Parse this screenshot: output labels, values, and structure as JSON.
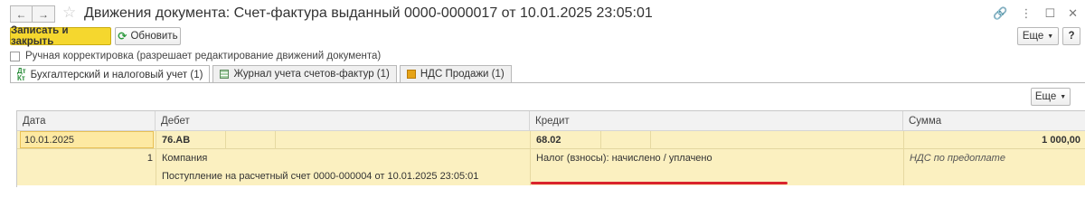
{
  "window": {
    "title": "Движения документа: Счет-фактура выданный 0000-0000017 от 10.01.2025 23:05:01",
    "back_icon": "arrow-left-icon",
    "forward_icon": "arrow-right-icon",
    "star_icon": "star-icon",
    "link_glyph": "🔗",
    "menu_glyph": "⋮",
    "maximize_glyph": "☐",
    "close_glyph": "✕"
  },
  "toolbar": {
    "save_close_label": "Записать и закрыть",
    "refresh_label": "Обновить",
    "more_label": "Еще",
    "help_label": "?"
  },
  "manual_correction": {
    "label": "Ручная корректировка (разрешает редактирование движений документа)",
    "checked": false
  },
  "tabs": [
    {
      "label": "Бухгалтерский и налоговый учет (1)",
      "icon_text": "Дт\nКт",
      "active": true
    },
    {
      "label": "Журнал учета счетов-фактур (1)",
      "active": false
    },
    {
      "label": "НДС Продажи (1)",
      "active": false
    }
  ],
  "table_toolbar": {
    "more_label": "Еще"
  },
  "table": {
    "columns": [
      "Дата",
      "Дебет",
      "Кредит",
      "Сумма"
    ],
    "row": {
      "date": "10.01.2025",
      "line_number": "1",
      "debit_account": "76.АВ",
      "debit_subconto1": "Компания",
      "debit_subconto2": "Поступление на расчетный счет 0000-000004 от 10.01.2025 23:05:01",
      "credit_account": "68.02",
      "credit_subconto1": "Налог (взносы): начислено / уплачено",
      "amount": "1 000,00",
      "content": "НДС по предоплате"
    }
  },
  "colors": {
    "primary_button": "#f5d72e",
    "row_highlight": "#fbf0c0",
    "annotation_underline": "#d9232d"
  }
}
